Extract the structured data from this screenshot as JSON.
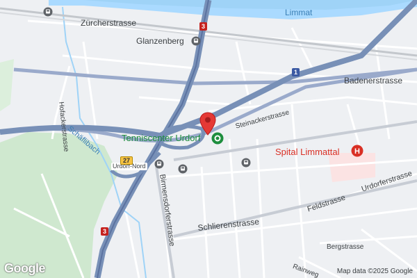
{
  "map": {
    "labels": {
      "river": "Limmat",
      "zurcherstrasse": "Zürcherstrasse",
      "glanzenberg": "Glanzenberg",
      "badenerstrasse": "Badenerstrasse",
      "hofackerstrasse": "Hofackerstrasse",
      "schaflibach": "Schäflibach",
      "steinackerstrasse": "Steinackerstrasse",
      "tenniscenter": "Tenniscenter Urdorf",
      "spital": "Spital Limmattal",
      "urdorf_nord": "Urdorf-Nord",
      "birmensdorferstrasse": "Birmensdorferstrasse",
      "feldstrasse": "Feldstrasse",
      "urdorferstrasse": "Urdorferstrasse",
      "schlierenstrasse": "Schlierenstrasse",
      "bergstrasse": "Bergstrasse",
      "rainweg": "Rainweg"
    },
    "shields": {
      "route3_top": "3",
      "route3_bottom": "3",
      "route1": "1",
      "exit27": "27"
    },
    "hospital_symbol": "H",
    "attribution": "Map data ©2025 Google",
    "logo": "Google",
    "colors": {
      "water": "#aadaff",
      "motorway": "#7890b7",
      "green": "#cfe8cf",
      "hospital_area": "#fbe3e3",
      "pin": "#e53935",
      "poi_green": "#1e8e3e",
      "poi_red": "#d93025"
    },
    "icons": [
      "transit-station-icon",
      "tennis-poi-icon",
      "hospital-icon",
      "map-pin-icon",
      "bus-stop-icon"
    ]
  }
}
